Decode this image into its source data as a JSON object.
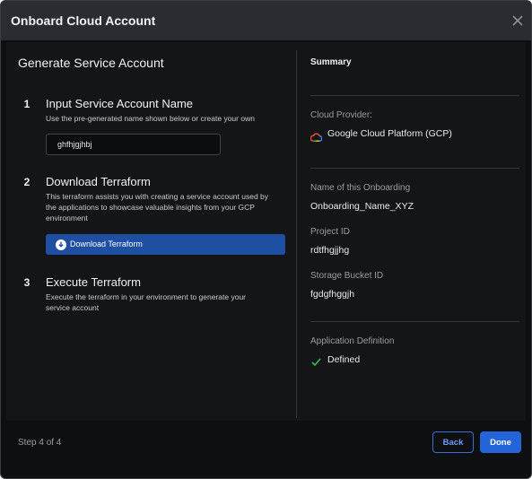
{
  "modal": {
    "title": "Onboard Cloud Account"
  },
  "left": {
    "title": "Generate Service Account",
    "steps": [
      {
        "number": "1",
        "title": "Input Service Account Name",
        "description": "Use the pre-generated name shown below or create your own"
      },
      {
        "number": "2",
        "title": "Download Terraform",
        "description_lines": [
          "This terraform assists you with creating a service account used by",
          "the applications to showcase valuable insights from your GCP",
          "environment"
        ]
      },
      {
        "number": "3",
        "title": "Execute Terraform",
        "description_lines": [
          "Execute the terraform in your environment to generate your",
          "service account"
        ]
      }
    ],
    "service_account_name": {
      "value": "ghfhjgjhbj",
      "placeholder": ""
    },
    "download_button_label": "Download Terraform"
  },
  "summary": {
    "title": "Summary",
    "cloud_provider_label": "Cloud Provider:",
    "cloud_provider_value": "Google Cloud Platform (GCP)",
    "onboarding_name_label": "Name of this Onboarding",
    "onboarding_name_value": "Onboarding_Name_XYZ",
    "project_id_label": "Project ID",
    "project_id_value": "rdtfhgjjhg",
    "bucket_id_label": "Storage Bucket ID",
    "bucket_id_value": "fgdgfhggjh",
    "app_def_label": "Application Definition",
    "app_def_value": "Defined"
  },
  "footer": {
    "step_text": "Step 4 of 4",
    "back_label": "Back",
    "done_label": "Done"
  },
  "icons": {
    "close": "close-icon",
    "download": "download-icon",
    "gcp": "google-cloud-icon",
    "check": "check-icon"
  },
  "colors": {
    "primary_button": "#2563d8",
    "download_button": "#1f4fa3",
    "success_check": "#3fb950"
  }
}
